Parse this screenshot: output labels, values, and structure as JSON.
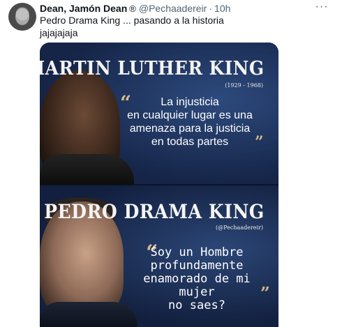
{
  "tweet": {
    "author_name": "Dean, Jamón Dean",
    "badge": "®",
    "handle": "@Pechaadereir",
    "separator": "·",
    "time": "10h",
    "more": "···",
    "text": "Pedro Drama King ... pasando a la historia\njajajajaja"
  },
  "image": {
    "top_title": "MARTIN LUTHER KING",
    "top_dates": "(1929 - 1968)",
    "top_quote": "La injusticia\nen cualquier lugar es una\namenaza para la justicia\nen todas partes",
    "bottom_title": "PEDRO DRAMA KING",
    "bottom_credit": "(@Pechaadereir)",
    "bottom_quote": "Soy un Hombre\nprofundamente\nenamorado de mi mujer\nno saes?",
    "open_quote": "“",
    "close_quote": "”"
  },
  "colors": {
    "text": "#0f1419",
    "muted": "#536471",
    "image_bg": "#1a2c52",
    "quote_mark": "#d4b98a"
  }
}
